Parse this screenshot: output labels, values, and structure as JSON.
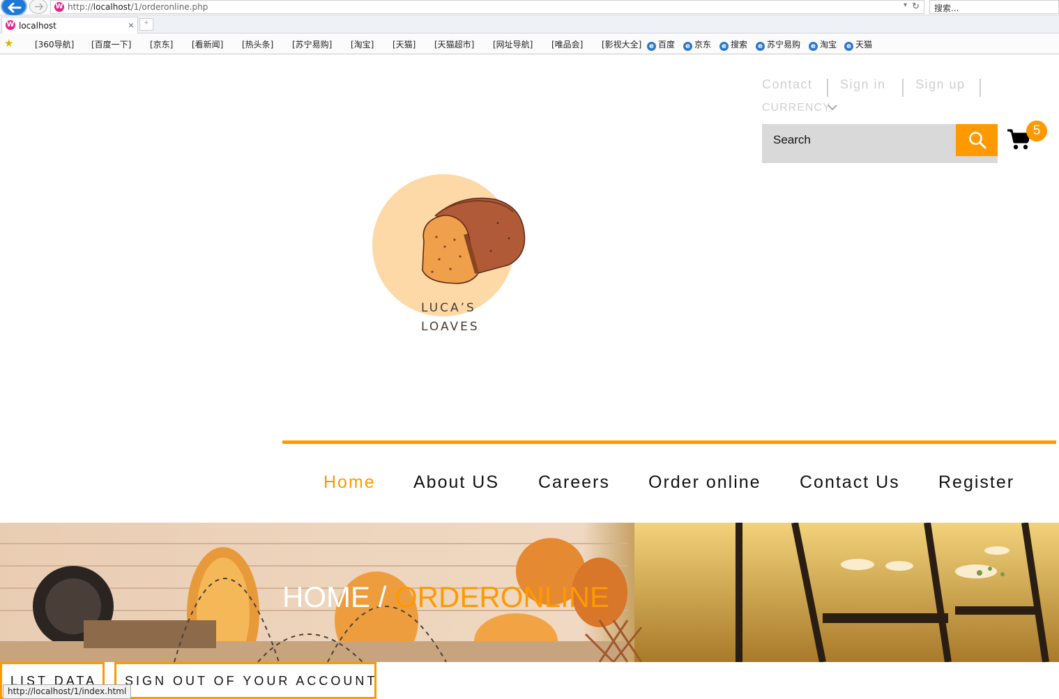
{
  "browser": {
    "url_prefix": "http://",
    "url_host": "localhost",
    "url_path": "/1/orderonline.php",
    "search_placeholder": "搜索...",
    "tab_title": "localhost",
    "site_icon_glyph": "W",
    "bookmarks": [
      "[360导航]",
      "[百度一下]",
      "[京东]",
      "[看新闻]",
      "[热头条]",
      "[苏宁易购]",
      "[淘宝]",
      "[天猫]",
      "[天猫超市]",
      "[网址导航]",
      "[唯品会]",
      "[影视大全]"
    ],
    "ie_bookmarks": [
      "百度",
      "京东",
      "搜索",
      "苏宁易购",
      "淘宝",
      "天猫"
    ],
    "status_url": "http://localhost/1/index.html"
  },
  "header": {
    "links": [
      "Contact",
      "Sign in",
      "Sign up"
    ],
    "currency_label": "CURRENCY",
    "search_placeholder": "Search",
    "cart_count": "5"
  },
  "logo": {
    "line1": "LUCA’S",
    "line2": "LOAVES"
  },
  "nav": {
    "items": [
      "Home",
      "About US",
      "Careers",
      "Order online",
      "Contact Us",
      "Register"
    ],
    "active_index": 0
  },
  "breadcrumb": {
    "home": "HOME",
    "separator": " / ",
    "current": "ORDERONLINE"
  },
  "actions": {
    "list_data": "LIST DATA",
    "sign_out": "SIGN OUT OF YOUR ACCOUNT"
  },
  "colors": {
    "accent": "#ff9900",
    "search_bg": "#d9d9d9",
    "link_muted": "#cfcfcf",
    "logo_circle": "#fdd9a8"
  },
  "icons": {
    "back": "back-arrow-icon",
    "forward": "forward-arrow-icon",
    "search": "search-icon",
    "cart": "shopping-cart-icon",
    "chevron": "chevron-down-icon",
    "favorites": "star-icon"
  }
}
